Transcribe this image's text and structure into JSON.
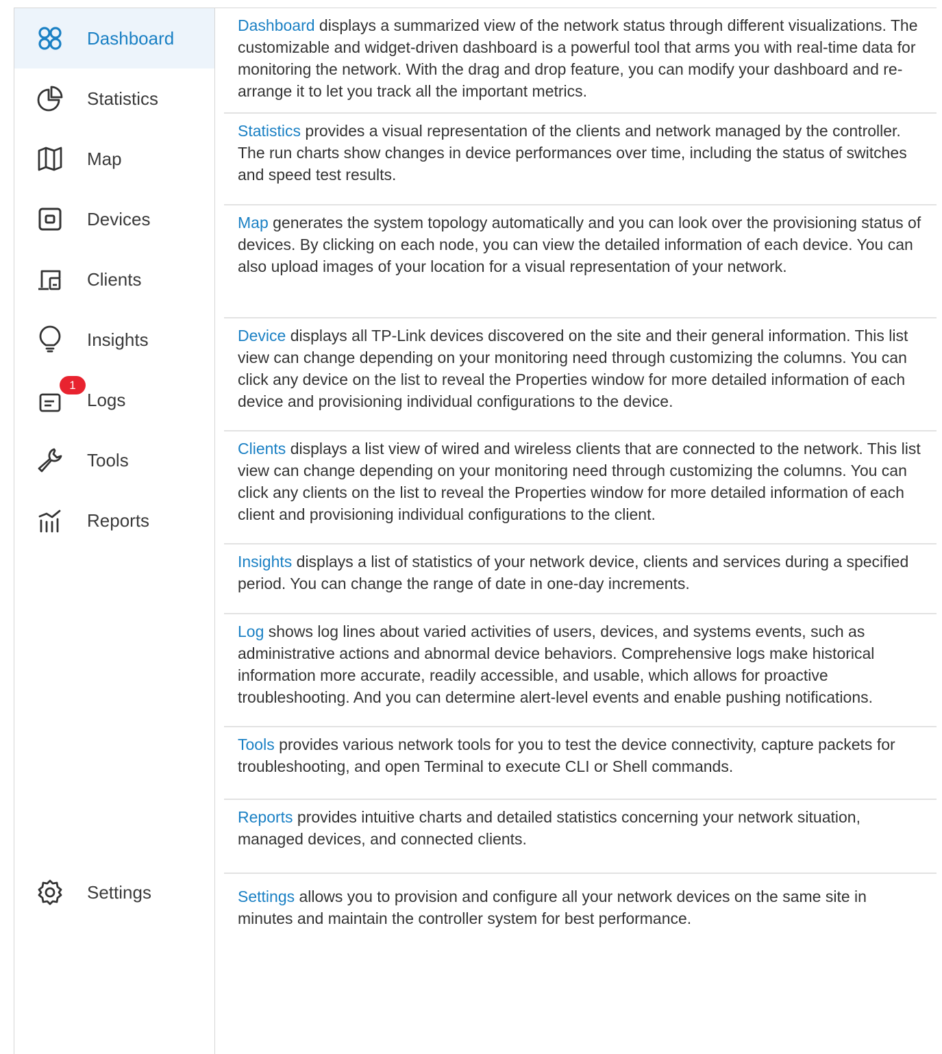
{
  "sidebar": {
    "items": [
      {
        "key": "dashboard",
        "label": "Dashboard",
        "icon": "dashboard-icon",
        "active": true
      },
      {
        "key": "statistics",
        "label": "Statistics",
        "icon": "pie-chart-icon"
      },
      {
        "key": "map",
        "label": "Map",
        "icon": "map-icon"
      },
      {
        "key": "devices",
        "label": "Devices",
        "icon": "device-icon"
      },
      {
        "key": "clients",
        "label": "Clients",
        "icon": "clients-icon"
      },
      {
        "key": "insights",
        "label": "Insights",
        "icon": "lightbulb-icon"
      },
      {
        "key": "logs",
        "label": "Logs",
        "icon": "logs-icon",
        "badge": "1"
      },
      {
        "key": "tools",
        "label": "Tools",
        "icon": "wrench-icon"
      },
      {
        "key": "reports",
        "label": "Reports",
        "icon": "reports-icon"
      },
      {
        "key": "settings",
        "label": "Settings",
        "icon": "gear-icon"
      }
    ]
  },
  "content": {
    "entries": [
      {
        "link": "Dashboard",
        "text": " displays a summarized view of the network status through different visualizations. The customizable and widget-driven dashboard is a powerful tool that arms you with real-time data for monitoring the network. With the drag and drop feature, you can modify your dashboard and re-arrange it to let you track all the important metrics."
      },
      {
        "link": "Statistics",
        "text": " provides a visual representation of the clients and network managed by the controller. The run charts show changes in device performances over time, including the status of switches and speed test results."
      },
      {
        "link": "Map",
        "text": " generates the system topology automatically and you can look over the provisioning status of devices. By clicking on each node, you can view the detailed information of each device. You can also upload images of your location for a visual representation of your network."
      },
      {
        "link": "Device",
        "text": " displays all TP-Link devices discovered on the site and their general information. This list view can change depending on your monitoring need through customizing the columns. You can click any device on the list to reveal the Properties window for more detailed information of each device and provisioning individual configurations to the device."
      },
      {
        "link": "Clients",
        "text": " displays a list view of wired and wireless clients that are connected to the network. This list view can change depending on your monitoring need through customizing the columns. You can click any clients on the list to reveal the Properties window for more detailed information of each client and provisioning individual configurations to the client."
      },
      {
        "link": "Insights",
        "text": " displays a list of statistics of your network device, clients and services during a specified period. You can change the range of date in one-day increments."
      },
      {
        "link": "Log",
        "text": " shows log lines about varied activities of users, devices, and systems events, such as administrative actions and abnormal device behaviors. Comprehensive logs make historical information more accurate, readily accessible, and usable, which allows for proactive troubleshooting. And you can determine alert-level events and enable pushing notifications."
      },
      {
        "link": "Tools",
        "text": " provides various network tools for you to test the device connectivity, capture packets for troubleshooting, and open Terminal to execute CLI or Shell commands."
      },
      {
        "link": "Reports",
        "text": " provides intuitive charts and detailed statistics concerning your network situation, managed devices, and connected clients."
      },
      {
        "link": "Settings",
        "text": " allows you to provision and configure all your network devices on the same site in minutes and maintain the controller system for best performance."
      }
    ]
  },
  "colors": {
    "accent": "#1a80c4",
    "active_bg": "#edf4fb",
    "badge": "#e8232f",
    "text": "#333333"
  }
}
